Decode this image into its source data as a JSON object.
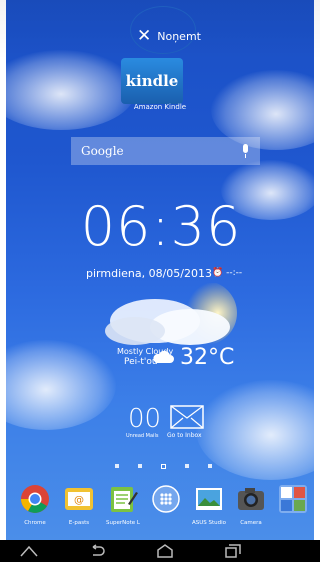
{
  "drop_target": {
    "remove_label": "Noņemt"
  },
  "dragging_app": {
    "icon_text": "kindle",
    "label": "Amazon Kindle"
  },
  "search": {
    "label": "Google"
  },
  "clock": {
    "time": "06:36",
    "date": "pirmdiena, 08/05/2013",
    "alarm": "--:--"
  },
  "weather": {
    "condition": "Mostly Cloudy",
    "city": "Pei-t'ou",
    "temp": "32°C"
  },
  "mail": {
    "count": "00",
    "unread_label": "Unread Mails",
    "go_label": "Go to Inbox"
  },
  "pager": {
    "pages": 5,
    "active_index": 2
  },
  "dock": {
    "apps": [
      {
        "label": "Chrome"
      },
      {
        "label": "E-pasts"
      },
      {
        "label": "SuperNote L"
      },
      {
        "label": ""
      },
      {
        "label": "ASUS Studio"
      },
      {
        "label": "Camera"
      },
      {
        "label": ""
      }
    ]
  },
  "navbar": {
    "icons": [
      "home-icon",
      "back-icon",
      "home-icon",
      "recents-icon"
    ]
  }
}
